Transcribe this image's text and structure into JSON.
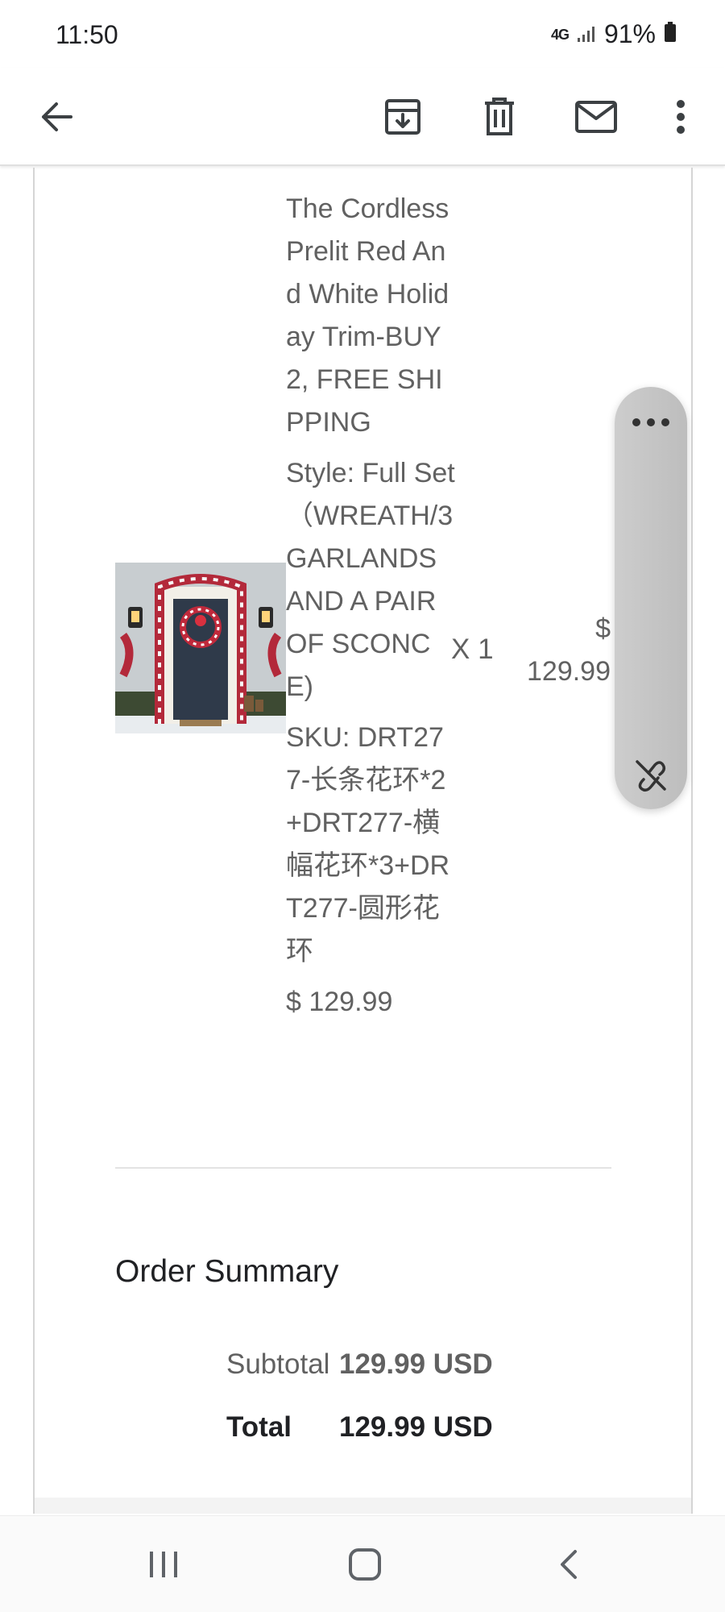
{
  "status_bar": {
    "time": "11:50",
    "network": "4G",
    "battery": "91%"
  },
  "toolbar": {
    "icons": [
      "back-arrow-icon",
      "archive-icon",
      "delete-icon",
      "mail-icon",
      "more-vert-icon"
    ]
  },
  "order": {
    "product_name": "The Cordless Prelit Red And White Holiday Trim-BUY 2, FREE SHIPPING",
    "style": "Style: Full Set（WREATH/3 GARLANDS AND A PAIR OF SCONCE)",
    "sku": "SKU: DRT277-长条花环*2+DRT277-横幅花环*3+DRT277-圆形花环",
    "unit_price": "$ 129.99",
    "quantity": "X 1",
    "line_total": "$ 129.99"
  },
  "summary": {
    "title": "Order Summary",
    "subtotal_label": "Subtotal",
    "subtotal_value": "129.99 USD",
    "total_label": "Total",
    "total_value": "129.99 USD"
  },
  "floating_widget": {
    "icons": [
      "more-horiz-icon",
      "pin-off-icon"
    ]
  },
  "nav_bar": {
    "icons": [
      "recents-icon",
      "home-icon",
      "back-icon"
    ]
  },
  "colors": {
    "primary_text": "#202124",
    "secondary_text": "#616161",
    "divider": "#e3e3e3",
    "pill": "#c4c4c4"
  }
}
